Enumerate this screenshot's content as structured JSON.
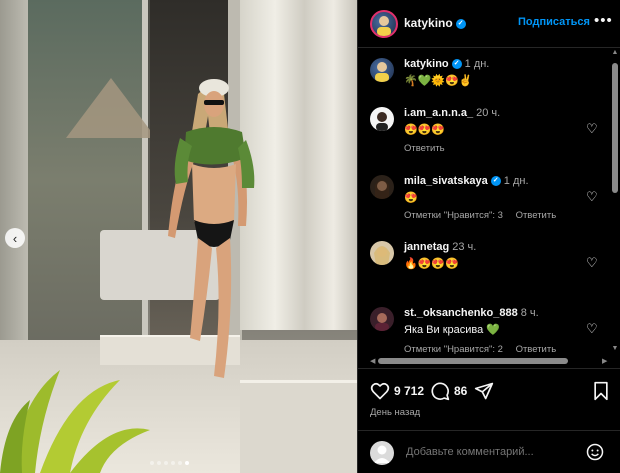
{
  "photo": {
    "active_index": 5,
    "dot_count": 6
  },
  "header": {
    "username": "katykino",
    "follow_label": "Подписаться",
    "more_label": "•••"
  },
  "caption": {
    "username": "katykino",
    "time": "1 дн.",
    "text": "🌴💚🌞😍✌️"
  },
  "comments": [
    {
      "username": "i.am_a.n.n.a_",
      "time": "20 ч.",
      "text": "😍😍😍",
      "verified": false,
      "actions": [
        "Ответить"
      ]
    },
    {
      "username": "mila_sivatskaya",
      "time": "1 дн.",
      "text": "😍",
      "verified": true,
      "actions": [
        "Отметки \"Нравится\": 3",
        "Ответить"
      ]
    },
    {
      "username": "jannetag",
      "time": "23 ч.",
      "text": "🔥😍😍😍",
      "verified": false,
      "actions": []
    },
    {
      "username": "st._oksanchenko_888",
      "time": "8 ч.",
      "text": "Яка Ви красива 💚",
      "verified": false,
      "actions": [
        "Отметки \"Нравится\": 2",
        "Ответить"
      ]
    }
  ],
  "actions": {
    "likes": "9 712",
    "comments": "86",
    "date": "День назад"
  },
  "composer": {
    "placeholder": "Добавьте комментарий..."
  },
  "colors": {
    "accent": "#0095f6",
    "background": "#000000",
    "muted": "#a8a8a8"
  }
}
